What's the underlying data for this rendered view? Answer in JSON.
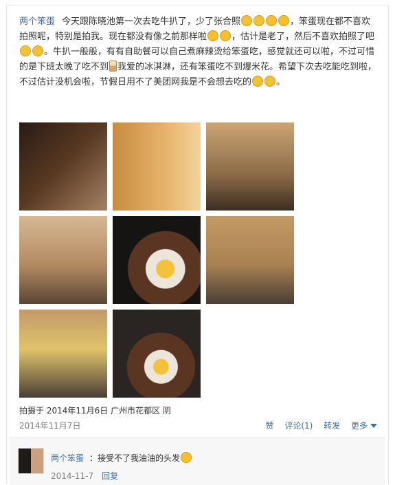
{
  "post": {
    "author": "两个笨蛋",
    "text_parts": [
      "今天跟陈晓池第一次去吃牛扒了，少了张合照",
      "，笨蛋现在都不喜欢拍照呢，特别是拍我。现在都没有像之前那样啦",
      "，估计是老了，然后不喜欢拍照了吧",
      "。牛扒一般般，有有自助餐可以自己煮麻辣烫给笨蛋吃，感觉就还可以啦，不过可惜的是下班太晚了吃不到",
      "我爱的冰淇淋，还有笨蛋吃不到爆米花。希望下次去吃能吃到啦，不过估计没机会啦，节假日用不了美团网我是不会想去吃的",
      "。"
    ],
    "location": "拍摄于 2014年11月6日 广州市花都区 阴",
    "date": "2014年11月7日",
    "photo_count": 8
  },
  "actions": {
    "like": "赞",
    "comment": "评论(1)",
    "share": "转发",
    "more": "更多"
  },
  "comment": {
    "author": "两个笨蛋",
    "text": "：接受不了我油油的头发",
    "date": "2014-11-7",
    "reply": "回复"
  },
  "colors": {
    "link": "#3f6ea4",
    "meta": "#808080",
    "emoji": "#f5c02a"
  }
}
